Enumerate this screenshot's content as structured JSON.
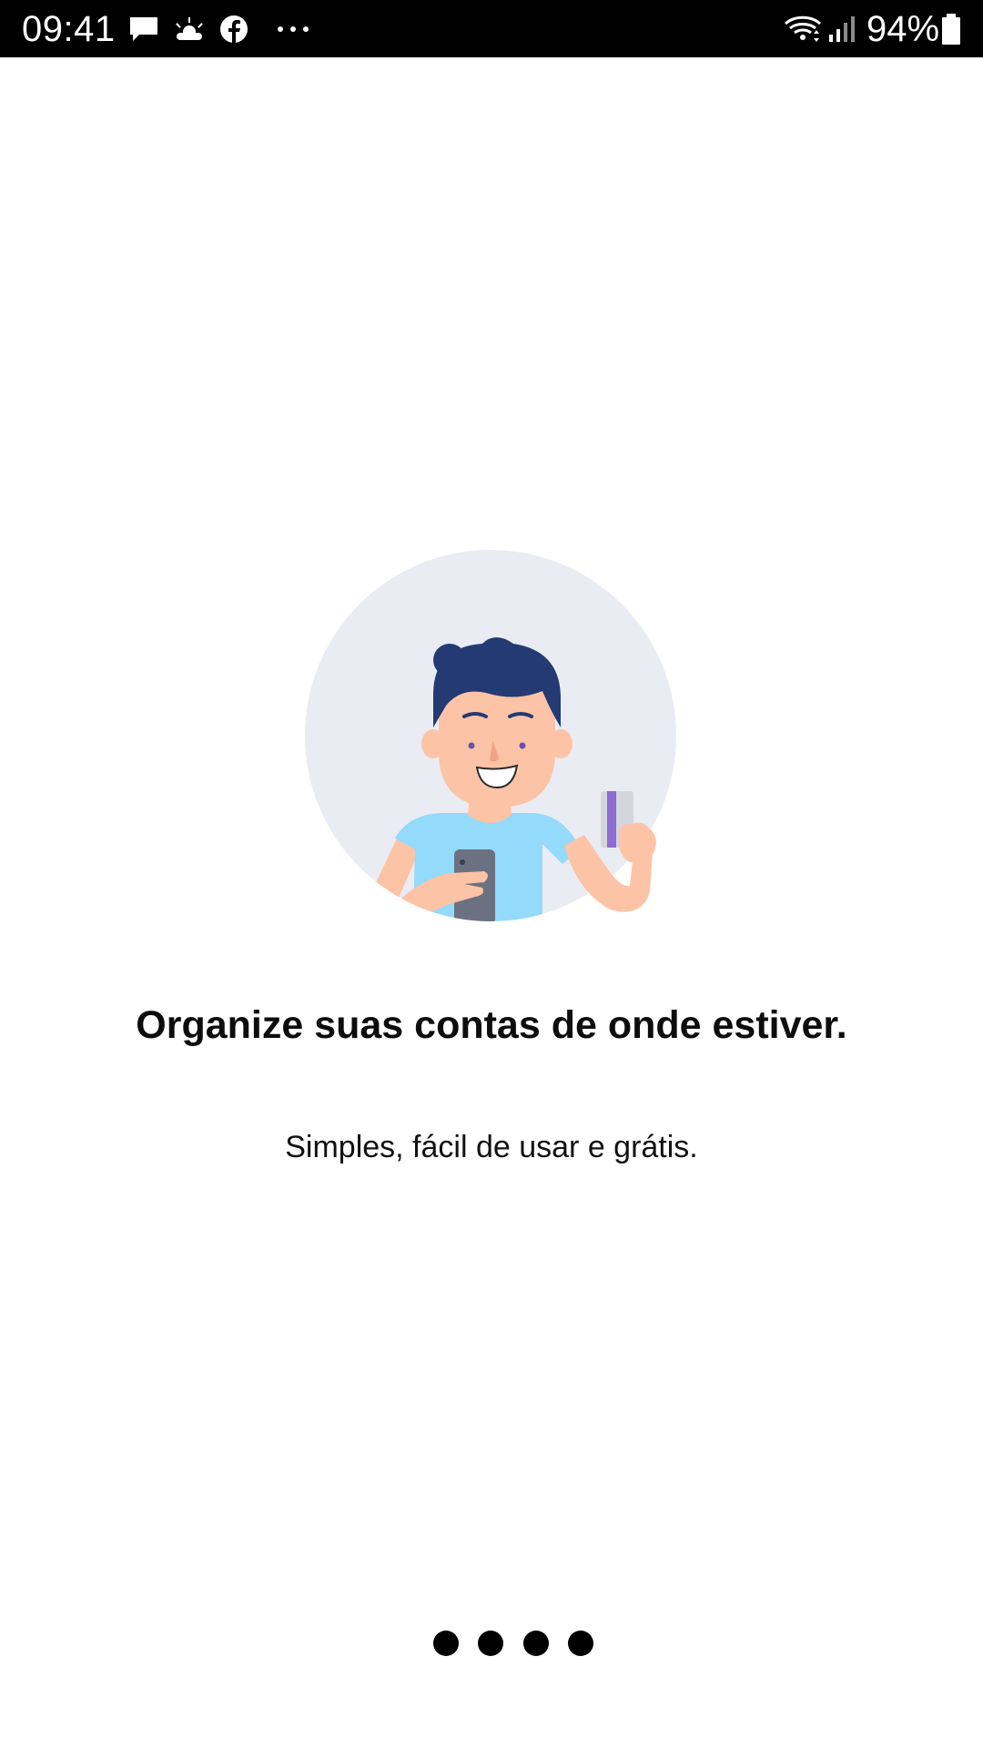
{
  "status_bar": {
    "time": "09:41",
    "notification_icons": [
      "message-icon",
      "weather-icon",
      "facebook-icon",
      "more-icon"
    ],
    "system_icons": [
      "wifi-icon",
      "signal-icon",
      "battery-icon"
    ],
    "battery_percent": "94%"
  },
  "onboarding": {
    "illustration": "person-with-phone-and-card",
    "title": "Organize suas contas de onde estiver.",
    "subtitle": "Simples, fácil de usar e grátis.",
    "page_dots": 4
  },
  "colors": {
    "status_bar_bg": "#000000",
    "illustration_circle": "#E9ECF2",
    "hair": "#233A72",
    "skin": "#FDC3A6",
    "shirt": "#93DAFB",
    "phone": "#6B7180",
    "card_stripe": "#8E6BD2",
    "text": "#0D0D0D"
  }
}
